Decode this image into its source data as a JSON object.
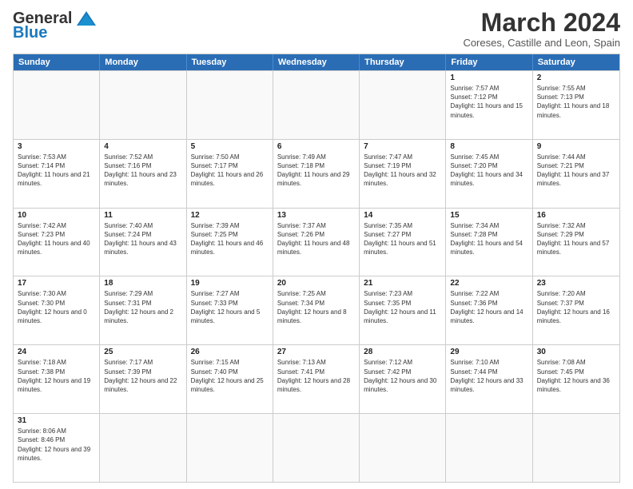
{
  "logo": {
    "line1": "General",
    "line2": "Blue"
  },
  "title": "March 2024",
  "subtitle": "Coreses, Castille and Leon, Spain",
  "header_days": [
    "Sunday",
    "Monday",
    "Tuesday",
    "Wednesday",
    "Thursday",
    "Friday",
    "Saturday"
  ],
  "weeks": [
    [
      {
        "day": "",
        "info": ""
      },
      {
        "day": "",
        "info": ""
      },
      {
        "day": "",
        "info": ""
      },
      {
        "day": "",
        "info": ""
      },
      {
        "day": "",
        "info": ""
      },
      {
        "day": "1",
        "info": "Sunrise: 7:57 AM\nSunset: 7:12 PM\nDaylight: 11 hours and 15 minutes."
      },
      {
        "day": "2",
        "info": "Sunrise: 7:55 AM\nSunset: 7:13 PM\nDaylight: 11 hours and 18 minutes."
      }
    ],
    [
      {
        "day": "3",
        "info": "Sunrise: 7:53 AM\nSunset: 7:14 PM\nDaylight: 11 hours and 21 minutes."
      },
      {
        "day": "4",
        "info": "Sunrise: 7:52 AM\nSunset: 7:16 PM\nDaylight: 11 hours and 23 minutes."
      },
      {
        "day": "5",
        "info": "Sunrise: 7:50 AM\nSunset: 7:17 PM\nDaylight: 11 hours and 26 minutes."
      },
      {
        "day": "6",
        "info": "Sunrise: 7:49 AM\nSunset: 7:18 PM\nDaylight: 11 hours and 29 minutes."
      },
      {
        "day": "7",
        "info": "Sunrise: 7:47 AM\nSunset: 7:19 PM\nDaylight: 11 hours and 32 minutes."
      },
      {
        "day": "8",
        "info": "Sunrise: 7:45 AM\nSunset: 7:20 PM\nDaylight: 11 hours and 34 minutes."
      },
      {
        "day": "9",
        "info": "Sunrise: 7:44 AM\nSunset: 7:21 PM\nDaylight: 11 hours and 37 minutes."
      }
    ],
    [
      {
        "day": "10",
        "info": "Sunrise: 7:42 AM\nSunset: 7:23 PM\nDaylight: 11 hours and 40 minutes."
      },
      {
        "day": "11",
        "info": "Sunrise: 7:40 AM\nSunset: 7:24 PM\nDaylight: 11 hours and 43 minutes."
      },
      {
        "day": "12",
        "info": "Sunrise: 7:39 AM\nSunset: 7:25 PM\nDaylight: 11 hours and 46 minutes."
      },
      {
        "day": "13",
        "info": "Sunrise: 7:37 AM\nSunset: 7:26 PM\nDaylight: 11 hours and 48 minutes."
      },
      {
        "day": "14",
        "info": "Sunrise: 7:35 AM\nSunset: 7:27 PM\nDaylight: 11 hours and 51 minutes."
      },
      {
        "day": "15",
        "info": "Sunrise: 7:34 AM\nSunset: 7:28 PM\nDaylight: 11 hours and 54 minutes."
      },
      {
        "day": "16",
        "info": "Sunrise: 7:32 AM\nSunset: 7:29 PM\nDaylight: 11 hours and 57 minutes."
      }
    ],
    [
      {
        "day": "17",
        "info": "Sunrise: 7:30 AM\nSunset: 7:30 PM\nDaylight: 12 hours and 0 minutes."
      },
      {
        "day": "18",
        "info": "Sunrise: 7:29 AM\nSunset: 7:31 PM\nDaylight: 12 hours and 2 minutes."
      },
      {
        "day": "19",
        "info": "Sunrise: 7:27 AM\nSunset: 7:33 PM\nDaylight: 12 hours and 5 minutes."
      },
      {
        "day": "20",
        "info": "Sunrise: 7:25 AM\nSunset: 7:34 PM\nDaylight: 12 hours and 8 minutes."
      },
      {
        "day": "21",
        "info": "Sunrise: 7:23 AM\nSunset: 7:35 PM\nDaylight: 12 hours and 11 minutes."
      },
      {
        "day": "22",
        "info": "Sunrise: 7:22 AM\nSunset: 7:36 PM\nDaylight: 12 hours and 14 minutes."
      },
      {
        "day": "23",
        "info": "Sunrise: 7:20 AM\nSunset: 7:37 PM\nDaylight: 12 hours and 16 minutes."
      }
    ],
    [
      {
        "day": "24",
        "info": "Sunrise: 7:18 AM\nSunset: 7:38 PM\nDaylight: 12 hours and 19 minutes."
      },
      {
        "day": "25",
        "info": "Sunrise: 7:17 AM\nSunset: 7:39 PM\nDaylight: 12 hours and 22 minutes."
      },
      {
        "day": "26",
        "info": "Sunrise: 7:15 AM\nSunset: 7:40 PM\nDaylight: 12 hours and 25 minutes."
      },
      {
        "day": "27",
        "info": "Sunrise: 7:13 AM\nSunset: 7:41 PM\nDaylight: 12 hours and 28 minutes."
      },
      {
        "day": "28",
        "info": "Sunrise: 7:12 AM\nSunset: 7:42 PM\nDaylight: 12 hours and 30 minutes."
      },
      {
        "day": "29",
        "info": "Sunrise: 7:10 AM\nSunset: 7:44 PM\nDaylight: 12 hours and 33 minutes."
      },
      {
        "day": "30",
        "info": "Sunrise: 7:08 AM\nSunset: 7:45 PM\nDaylight: 12 hours and 36 minutes."
      }
    ],
    [
      {
        "day": "31",
        "info": "Sunrise: 8:06 AM\nSunset: 8:46 PM\nDaylight: 12 hours and 39 minutes."
      },
      {
        "day": "",
        "info": ""
      },
      {
        "day": "",
        "info": ""
      },
      {
        "day": "",
        "info": ""
      },
      {
        "day": "",
        "info": ""
      },
      {
        "day": "",
        "info": ""
      },
      {
        "day": "",
        "info": ""
      }
    ]
  ],
  "accent_color": "#2a6db5"
}
